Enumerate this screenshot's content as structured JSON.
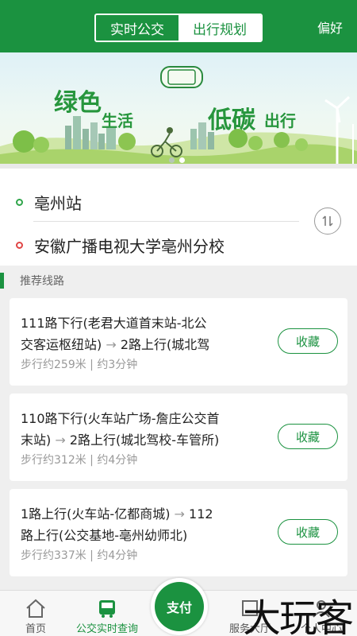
{
  "header": {
    "tabs": [
      {
        "label": "实时公交",
        "active": false
      },
      {
        "label": "出行规划",
        "active": true
      }
    ],
    "preference_label": "偏好",
    "accent": "#1b9240"
  },
  "banner": {
    "text_green": "绿色",
    "text_life": "生活",
    "text_lowcarbon": "低碳",
    "text_travel": "出行",
    "bus_sign": "BZG"
  },
  "route": {
    "from": "亳州站",
    "to": "安徽广播电视大学亳州分校",
    "swap_icon": "swap-vertical-icon"
  },
  "section_title": "推荐线路",
  "cards": [
    {
      "line1": "111路下行(老君大道首末站-北公",
      "line2_a": "交客运枢纽站)",
      "line2_arrow": "→",
      "line2_b": "2路上行(城北驾",
      "meta": "步行约259米 | 约3分钟",
      "fav_label": "收藏"
    },
    {
      "line1": "110路下行(火车站广场-詹庄公交首",
      "line2_a": "末站)",
      "line2_arrow": "→",
      "line2_b": "2路上行(城北驾校-车管所)",
      "meta": "步行约312米 | 约4分钟",
      "fav_label": "收藏"
    },
    {
      "line1_a": "1路上行(火车站-亿都商城)",
      "line1_arrow": "→",
      "line1_b": "112",
      "line2": "路上行(公交基地-亳州幼师北)",
      "meta": "步行约337米 | 约4分钟",
      "fav_label": "收藏"
    }
  ],
  "tabbar": {
    "items": [
      {
        "label": "首页",
        "icon": "home-icon"
      },
      {
        "label": "公交实时查询",
        "icon": "bus-icon"
      },
      {
        "label": "服务大厅",
        "icon": "service-icon"
      },
      {
        "label": "个人中心",
        "icon": "user-icon"
      }
    ],
    "pay_label": "支付"
  },
  "watermark": "大玩客"
}
